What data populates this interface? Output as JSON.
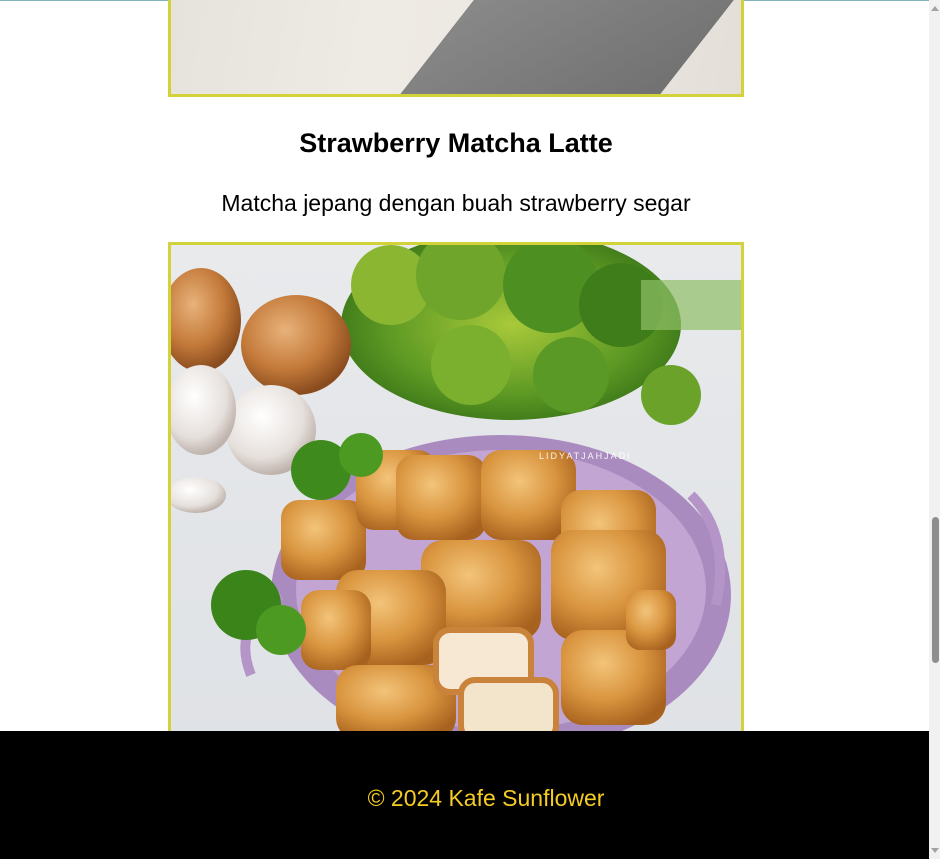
{
  "menu_item": {
    "title": "Strawberry Matcha Latte",
    "description": "Matcha jepang dengan buah strawberry segar"
  },
  "photos": {
    "top_photo_icon": "drink-photo",
    "food_photo_icon": "fried-tofu-photo",
    "food_photo_watermark": "LIDYATJAHJADI"
  },
  "footer": {
    "copyright": "© 2024 Kafe Sunflower"
  },
  "colors": {
    "frame_border": "#d2d23a",
    "footer_background": "#000000",
    "footer_text": "#f4cc22"
  }
}
